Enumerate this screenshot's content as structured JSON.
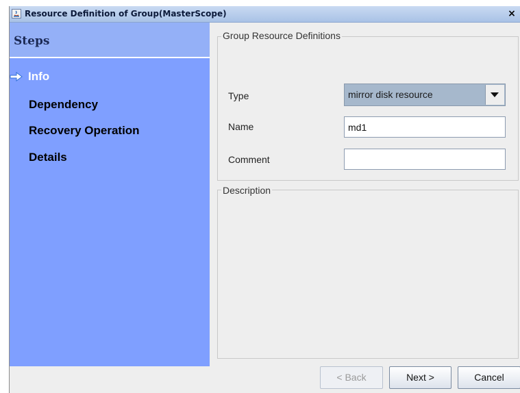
{
  "window": {
    "title": "Resource Definition of Group(MasterScope)",
    "close_label": "×"
  },
  "sidebar": {
    "header": "Steps",
    "steps": [
      {
        "label": "Info",
        "current": true
      },
      {
        "label": "Dependency",
        "current": false
      },
      {
        "label": "Recovery Operation",
        "current": false
      },
      {
        "label": "Details",
        "current": false
      }
    ]
  },
  "definitions": {
    "legend": "Group Resource Definitions",
    "type": {
      "label": "Type",
      "value": "mirror disk resource"
    },
    "name": {
      "label": "Name",
      "value": "md1"
    },
    "comment": {
      "label": "Comment",
      "value": ""
    }
  },
  "description": {
    "legend": "Description"
  },
  "buttons": {
    "back": "< Back",
    "next": "Next >",
    "cancel": "Cancel"
  },
  "icons": {
    "title": "java-app-icon",
    "current_step": "arrow-right-icon",
    "combo": "triangle-down-icon"
  },
  "colors": {
    "sidebar": "#7f9fff",
    "combo_bg": "#a6b8cc",
    "current_step_text": "#ffffff"
  }
}
